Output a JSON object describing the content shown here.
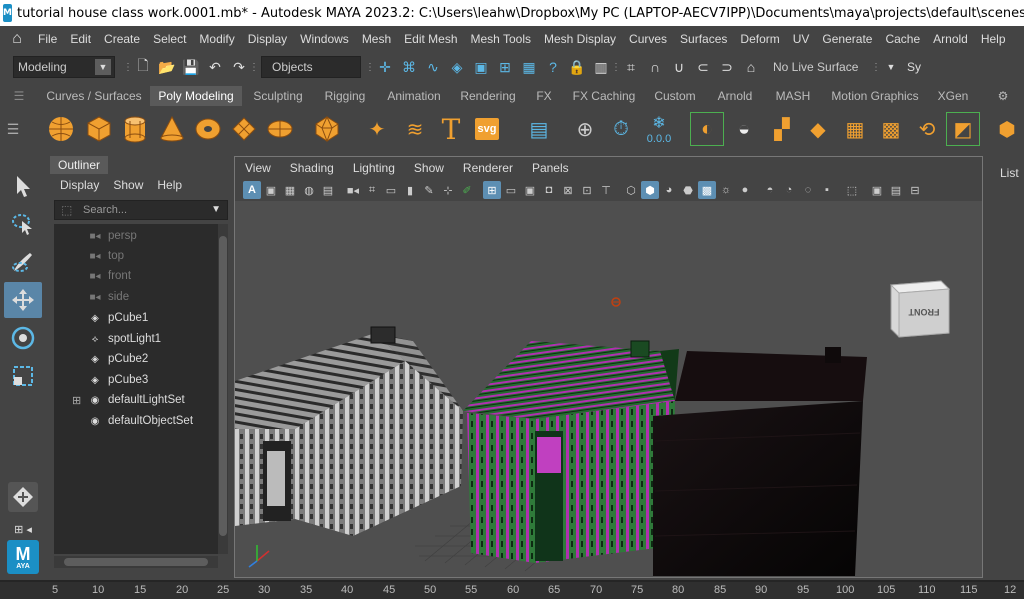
{
  "window": {
    "title": "tutorial house class work.0001.mb* - Autodesk MAYA 2023.2: C:\\Users\\leahw\\Dropbox\\My PC (LAPTOP-AECV7IPP)\\Documents\\maya\\projects\\default\\scenes\\tutorial house class work."
  },
  "menubar": {
    "items": [
      "File",
      "Edit",
      "Create",
      "Select",
      "Modify",
      "Display",
      "Windows",
      "Mesh",
      "Edit Mesh",
      "Mesh Tools",
      "Mesh Display",
      "Curves",
      "Surfaces",
      "Deform",
      "UV",
      "Generate",
      "Cache",
      "Arnold",
      "Help"
    ]
  },
  "statusline": {
    "menu_set": "Modeling",
    "select_mode": "Objects",
    "live_surface": "No Live Surface",
    "trailing": "Sy"
  },
  "shelf": {
    "tabs": [
      "Curves / Surfaces",
      "Poly Modeling",
      "Sculpting",
      "Rigging",
      "Animation",
      "Rendering",
      "FX",
      "FX Caching",
      "Custom",
      "Arnold",
      "MASH",
      "Motion Graphics",
      "XGen"
    ],
    "active_tab": "Poly Modeling",
    "text_icon": "T",
    "svg_icon": "svg",
    "value_icon": "0.0.0"
  },
  "outliner": {
    "title": "Outliner",
    "menus": [
      "Display",
      "Show",
      "Help"
    ],
    "search_placeholder": "Search...",
    "items": [
      {
        "name": "persp",
        "icon": "camera-icon",
        "dim": true
      },
      {
        "name": "top",
        "icon": "camera-icon",
        "dim": true
      },
      {
        "name": "front",
        "icon": "camera-icon",
        "dim": true
      },
      {
        "name": "side",
        "icon": "camera-icon",
        "dim": true
      },
      {
        "name": "pCube1",
        "icon": "mesh-icon",
        "dim": false
      },
      {
        "name": "spotLight1",
        "icon": "spotlight-icon",
        "dim": false
      },
      {
        "name": "pCube2",
        "icon": "mesh-icon",
        "dim": false
      },
      {
        "name": "pCube3",
        "icon": "mesh-icon",
        "dim": false
      },
      {
        "name": "defaultLightSet",
        "icon": "set-icon",
        "dim": false
      },
      {
        "name": "defaultObjectSet",
        "icon": "set-icon",
        "dim": false
      }
    ]
  },
  "viewport": {
    "menus": [
      "View",
      "Shading",
      "Lighting",
      "Show",
      "Renderer",
      "Panels"
    ],
    "view_cube_label": "FRONT"
  },
  "right_panel": {
    "label": "List"
  },
  "toolbox": {
    "logo": "M",
    "logo_sub": "AYA"
  },
  "timeslider": {
    "ticks": [
      "5",
      "10",
      "15",
      "20",
      "25",
      "30",
      "35",
      "40",
      "45",
      "50",
      "55",
      "60",
      "65",
      "70",
      "75",
      "80",
      "85",
      "90",
      "95",
      "100",
      "105",
      "110",
      "115",
      "12"
    ]
  },
  "colors": {
    "ui_bg": "#444444",
    "selection_blue": "#5a86a8",
    "shelf_orange": "#f0a030",
    "house_green": "#2f7a3a",
    "house_magenta": "#b030b0"
  }
}
